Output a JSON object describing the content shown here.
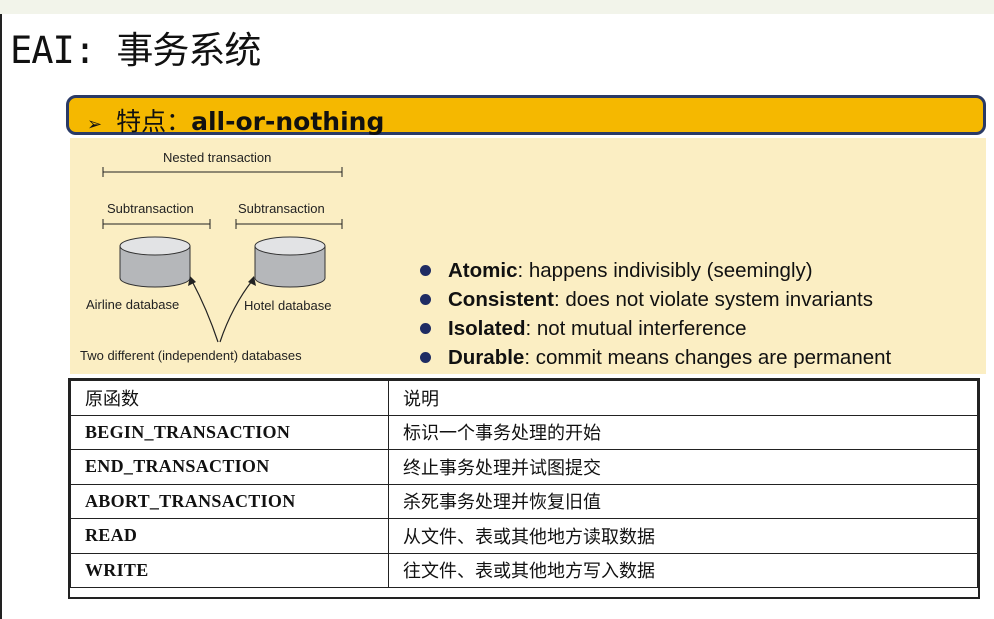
{
  "title": "EAI: 事务系统",
  "heading": {
    "bullet": "➢",
    "prefix": "特点：",
    "emphasis": "all-or-nothing"
  },
  "diagram": {
    "nested_label": "Nested transaction",
    "sub_label_1": "Subtransaction",
    "sub_label_2": "Subtransaction",
    "db_label_1": "Airline database",
    "db_label_2": "Hotel database",
    "caption": "Two different (independent) databases"
  },
  "properties": [
    {
      "term": "Atomic",
      "desc": ": happens indivisibly (seemingly)"
    },
    {
      "term": "Consistent",
      "desc": ": does not violate system invariants"
    },
    {
      "term": "Isolated",
      "desc": ": not mutual interference"
    },
    {
      "term": "Durable",
      "desc": ": commit means changes are permanent"
    }
  ],
  "table": {
    "headers": [
      "原函数",
      "说明"
    ],
    "rows": [
      [
        "BEGIN_TRANSACTION",
        "标识一个事务处理的开始"
      ],
      [
        "END_TRANSACTION",
        "终止事务处理并试图提交"
      ],
      [
        "ABORT_TRANSACTION",
        "杀死事务处理并恢复旧值"
      ],
      [
        "READ",
        "从文件、表或其他地方读取数据"
      ],
      [
        "WRITE",
        "往文件、表或其他地方写入数据"
      ]
    ]
  },
  "colors": {
    "heading_bar": "#f5b800",
    "heading_border": "#2a3a66",
    "panel": "#fbeec3",
    "bullet_dot": "#1f2c63"
  }
}
